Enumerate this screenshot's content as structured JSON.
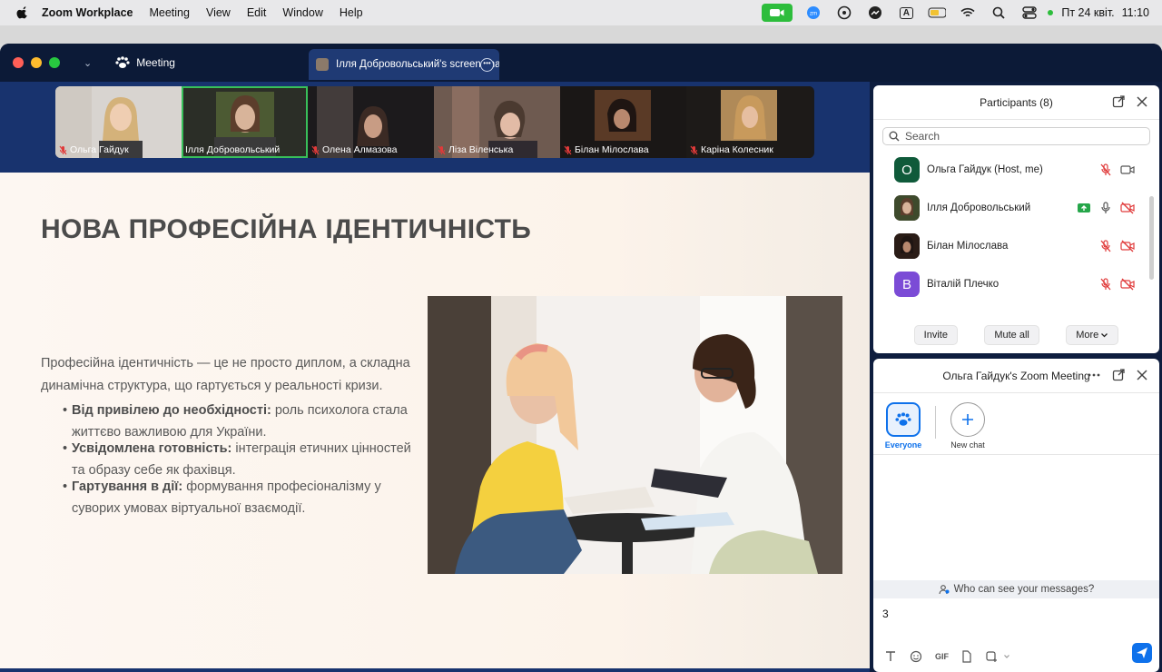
{
  "menubar": {
    "app_name": "Zoom Workplace",
    "items": [
      "Meeting",
      "View",
      "Edit",
      "Window",
      "Help"
    ],
    "date": "Пт 24 квіт.",
    "time": "11:10",
    "status_icons": [
      "facetime-icon",
      "zoom-icon",
      "viber-icon",
      "messenger-icon",
      "input-source-icon",
      "battery-icon",
      "wifi-icon",
      "spotlight-icon",
      "control-center-icon",
      "siri-icon"
    ],
    "input_source": "A"
  },
  "titlebar": {
    "meeting_tab": "Meeting",
    "share_tab": "Ілля Добровольський's screen share"
  },
  "gallery": {
    "participants": [
      {
        "name": "Ольга Гайдук",
        "muted": true
      },
      {
        "name": "Ілля Добровольський",
        "muted": false
      },
      {
        "name": "Олена Алмазова",
        "muted": true
      },
      {
        "name": "Ліза Віленська",
        "muted": true
      },
      {
        "name": "Білан Мілослава",
        "muted": true
      },
      {
        "name": "Каріна Колесник",
        "muted": true
      }
    ]
  },
  "slide": {
    "title": "НОВА ПРОФЕСІЙНА ІДЕНТИЧНІСТЬ",
    "intro": "Професійна ідентичність — це не просто диплом, а складна динамічна структура, що гартується у реальності кризи.",
    "bullets": [
      {
        "bold": "Від привілею до необхідності:",
        "text": " роль психолога стала життєво важливою для України."
      },
      {
        "bold": "Усвідомлена готовність:",
        "text": " інтеграція етичних цінностей та образу себе як фахівця."
      },
      {
        "bold": "Гартування в дії:",
        "text": " формування професіоналізму у суворих умовах віртуальної взаємодії."
      }
    ]
  },
  "participants_panel": {
    "title": "Participants (8)",
    "search_placeholder": "Search",
    "rows": [
      {
        "name": "Ольга Гайдук (Host, me)",
        "initial": "О",
        "avatar_color": "#0f5a3a"
      },
      {
        "name": "Ілля Добровольський",
        "initial": "",
        "avatar_color": "#5a4a3a"
      },
      {
        "name": "Білан Мілослава",
        "initial": "",
        "avatar_color": "#3a2a22"
      },
      {
        "name": "Віталій Плечко",
        "initial": "В",
        "avatar_color": "#7b4bd6"
      }
    ],
    "invite": "Invite",
    "mute_all": "Mute all",
    "more": "More"
  },
  "chat_panel": {
    "title": "Ольга Гайдук's Zoom Meeting",
    "everyone": "Everyone",
    "new_chat": "New chat",
    "who_can_see": "Who can see your messages?",
    "input_value": "3"
  },
  "colors": {
    "zoom_blue": "#0e71eb",
    "muted_red": "#e03a3a",
    "active_green": "#38c05a",
    "stage_blue": "#18336e"
  }
}
